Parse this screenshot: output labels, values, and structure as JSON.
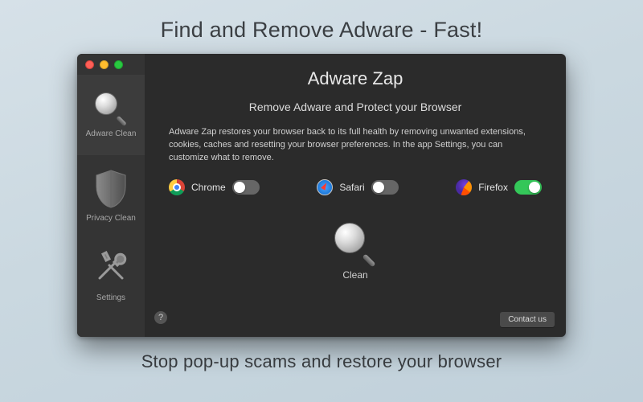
{
  "promo": {
    "headline": "Find and Remove Adware - Fast!",
    "tagline": "Stop pop-up scams and restore your browser"
  },
  "window": {
    "title": "Adware Zap",
    "subtitle": "Remove Adware and Protect your Browser",
    "description": "Adware Zap restores your browser back to its full health by removing unwanted extensions, cookies, caches and resetting your browser preferences. In the app Settings, you can customize what to remove."
  },
  "sidebar": {
    "items": [
      {
        "id": "adware-clean",
        "label": "Adware Clean",
        "icon": "magnifier-icon",
        "active": true
      },
      {
        "id": "privacy-clean",
        "label": "Privacy Clean",
        "icon": "shield-icon",
        "active": false
      },
      {
        "id": "settings",
        "label": "Settings",
        "icon": "tools-icon",
        "active": false
      }
    ]
  },
  "browsers": [
    {
      "id": "chrome",
      "label": "Chrome",
      "icon": "chrome-icon",
      "enabled": false
    },
    {
      "id": "safari",
      "label": "Safari",
      "icon": "safari-icon",
      "enabled": false
    },
    {
      "id": "firefox",
      "label": "Firefox",
      "icon": "firefox-icon",
      "enabled": true
    }
  ],
  "actions": {
    "clean_label": "Clean",
    "help_label": "?",
    "contact_label": "Contact us"
  },
  "colors": {
    "accent_green": "#34c759",
    "window_bg": "#2b2b2b",
    "sidebar_bg": "#343434"
  }
}
